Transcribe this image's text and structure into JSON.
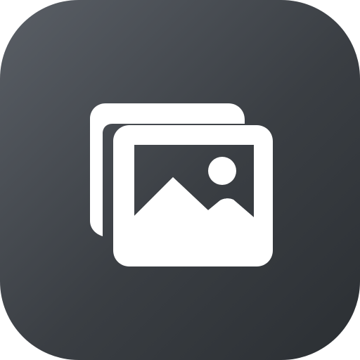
{
  "app_icon": {
    "icon": "photo-stack-icon",
    "colors": {
      "tile_gradient_start": "#5a5f66",
      "tile_gradient_mid": "#3a3e43",
      "tile_gradient_end": "#2b2f33",
      "glyph": "#ffffff"
    }
  }
}
